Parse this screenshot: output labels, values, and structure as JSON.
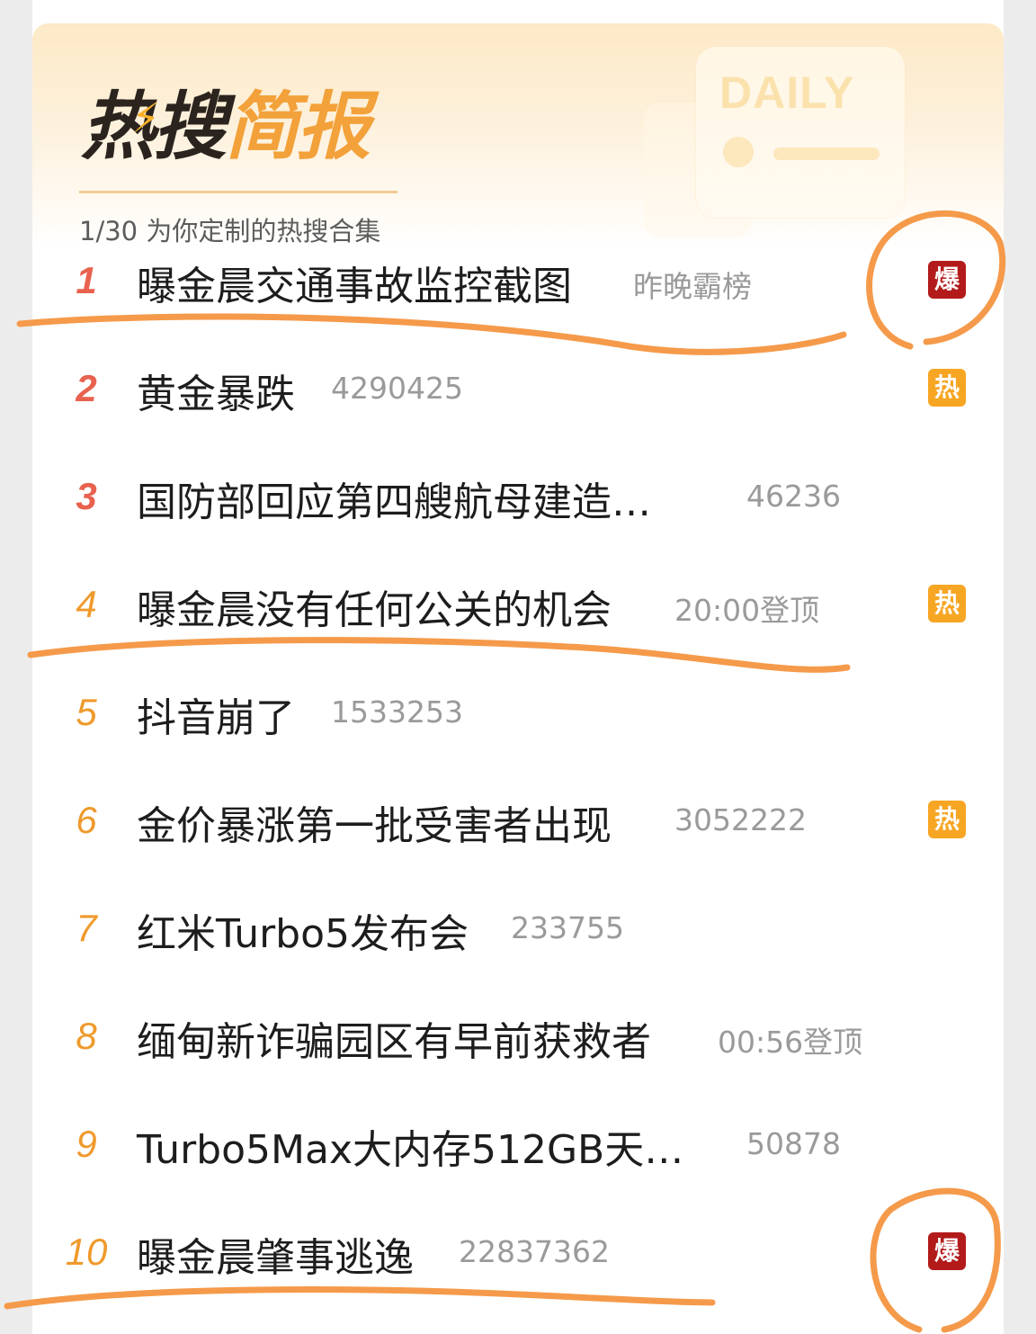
{
  "header": {
    "logo_part1": "热搜",
    "logo_part2": "简报",
    "daily_label": "DAILY",
    "subtitle": "1/30 为你定制的热搜合集"
  },
  "items": [
    {
      "rank": "1",
      "title": "曝金晨交通事故监控截图",
      "meta": "昨晚霸榜",
      "badge": "爆",
      "badge_type": "bao"
    },
    {
      "rank": "2",
      "title": "黄金暴跌",
      "meta": "4290425",
      "badge": "热",
      "badge_type": "re"
    },
    {
      "rank": "3",
      "title": "国防部回应第四艘航母建造…",
      "meta": "46236",
      "badge": "",
      "badge_type": ""
    },
    {
      "rank": "4",
      "title": "曝金晨没有任何公关的机会",
      "meta": "20:00登顶",
      "badge": "热",
      "badge_type": "re"
    },
    {
      "rank": "5",
      "title": "抖音崩了",
      "meta": "1533253",
      "badge": "",
      "badge_type": ""
    },
    {
      "rank": "6",
      "title": "金价暴涨第一批受害者出现",
      "meta": "3052222",
      "badge": "热",
      "badge_type": "re"
    },
    {
      "rank": "7",
      "title": "红米Turbo5发布会",
      "meta": "233755",
      "badge": "",
      "badge_type": ""
    },
    {
      "rank": "8",
      "title": "缅甸新诈骗园区有早前获救者",
      "meta": "00:56登顶",
      "badge": "",
      "badge_type": ""
    },
    {
      "rank": "9",
      "title": "Turbo5Max大内存512GB天…",
      "meta": "50878",
      "badge": "",
      "badge_type": ""
    },
    {
      "rank": "10",
      "title": "曝金晨肇事逃逸",
      "meta": "22837362",
      "badge": "爆",
      "badge_type": "bao"
    }
  ],
  "colors": {
    "rank_top": "#e8624f",
    "rank_other": "#ef9a2c",
    "badge_bao": "#b31b1b",
    "badge_re": "#f7a624",
    "annotation": "#f59a4a"
  }
}
